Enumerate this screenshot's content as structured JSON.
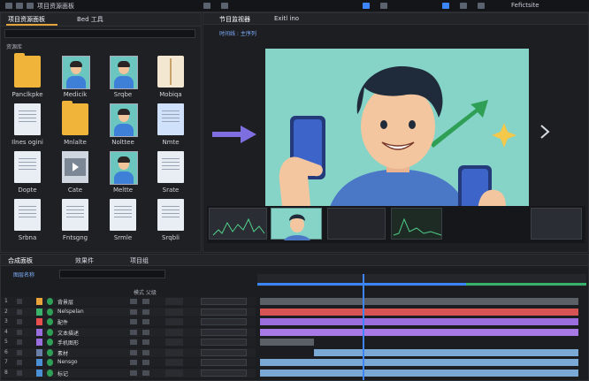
{
  "header": {
    "left_title": "项目资源面板",
    "left_tab2": "Bed 工具",
    "monitor_title": "节目监视器",
    "monitor_tab2": "Exitl ino",
    "right_title": "Fefictsite",
    "sub_tab": "时间线 : 主序列"
  },
  "project_panel": {
    "heading": "资源库",
    "items": [
      {
        "label": "Panclkpke",
        "kind": "folder-doc"
      },
      {
        "label": "Medicik",
        "kind": "portrait"
      },
      {
        "label": "Srqbe",
        "kind": "portrait"
      },
      {
        "label": "Mobiqa",
        "kind": "book"
      },
      {
        "label": "Ilnes ogini",
        "kind": "doc"
      },
      {
        "label": "Mnlalte",
        "kind": "folder"
      },
      {
        "label": "Nolttee",
        "kind": "portrait"
      },
      {
        "label": "Nmte",
        "kind": "doc-blue"
      },
      {
        "label": "Dopte",
        "kind": "doc"
      },
      {
        "label": "Cate",
        "kind": "video"
      },
      {
        "label": "Meltte",
        "kind": "portrait-folder"
      },
      {
        "label": "Srate",
        "kind": "doc"
      },
      {
        "label": "Srbna",
        "kind": "doc"
      },
      {
        "label": "Fntsgng",
        "kind": "doc"
      },
      {
        "label": "Srmle",
        "kind": "doc"
      },
      {
        "label": "Srqbli",
        "kind": "doc"
      }
    ]
  },
  "timeline": {
    "tabs": [
      "合成面板",
      "效果件",
      "项目组"
    ],
    "layers_header": "图层名称",
    "columns_header": "模式 父级",
    "layers": [
      {
        "index": "1",
        "name": "背景层",
        "color": "#e8a33a"
      },
      {
        "index": "2",
        "name": "Nelspelan",
        "color": "#3bb36a"
      },
      {
        "index": "3",
        "name": "配件",
        "color": "#e84f4f"
      },
      {
        "index": "4",
        "name": "文本描述",
        "color": "#9b6ee0"
      },
      {
        "index": "5",
        "name": "手机图形",
        "color": "#9b6ee0"
      },
      {
        "index": "6",
        "name": "素材",
        "color": "#6a7fa8"
      },
      {
        "index": "7",
        "name": "Nensgo",
        "color": "#4b8fd6"
      },
      {
        "index": "8",
        "name": "标记",
        "color": "#4b8fd6"
      }
    ],
    "tracks": [
      {
        "start": 0.0,
        "end": 1.0,
        "color": "#5b5f66"
      },
      {
        "start": 0.0,
        "end": 1.0,
        "color": "#d65454"
      },
      {
        "start": 0.0,
        "end": 1.0,
        "color": "#9b6ee0"
      },
      {
        "start": 0.0,
        "end": 1.0,
        "color": "#a77ae6"
      },
      {
        "start": 0.0,
        "end": 0.17,
        "color": "#5b5f66"
      },
      {
        "start": 0.17,
        "end": 1.0,
        "color": "#79a9d4"
      },
      {
        "start": 0.0,
        "end": 1.0,
        "color": "#79a9d4"
      },
      {
        "start": 0.0,
        "end": 1.0,
        "color": "#79a9d4"
      }
    ],
    "playhead_fraction": 0.32
  }
}
